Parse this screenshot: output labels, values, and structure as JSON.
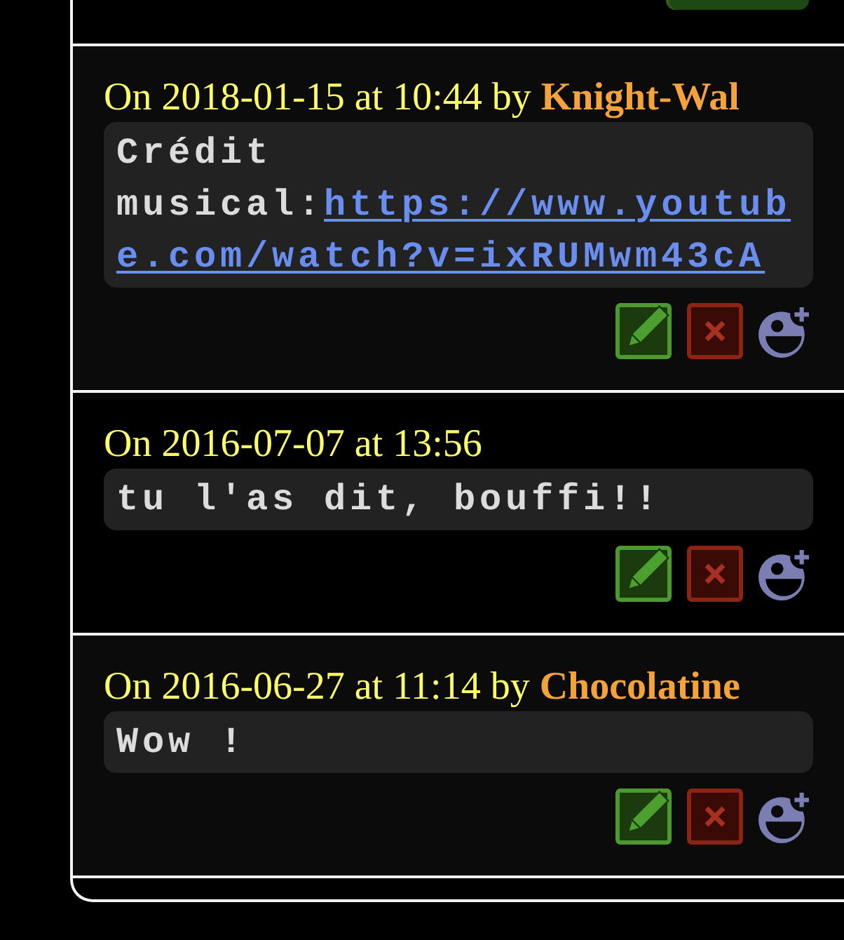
{
  "comments": [
    {
      "meta": "On 2018-01-15 at 10:44 by",
      "author": "Knight-Wal",
      "message": "Crédit musical:",
      "link_lines": [
        "https://www.youtub",
        "e.com/watch?v=ixRUMwm43cA"
      ],
      "actions": [
        {
          "kind": "edit"
        },
        {
          "kind": "delete"
        },
        {
          "kind": "react"
        }
      ]
    },
    {
      "meta": "On 2016-07-07 at 13:56",
      "message": "tu l'as dit, bouffi!!",
      "actions": [
        {
          "kind": "edit"
        },
        {
          "kind": "delete"
        },
        {
          "kind": "react"
        }
      ]
    },
    {
      "meta": "On 2016-06-27 at 11:14 by",
      "author": "Chocolatine",
      "message": "Wow !",
      "actions": [
        {
          "kind": "edit"
        },
        {
          "kind": "delete"
        },
        {
          "kind": "react"
        }
      ]
    }
  ]
}
